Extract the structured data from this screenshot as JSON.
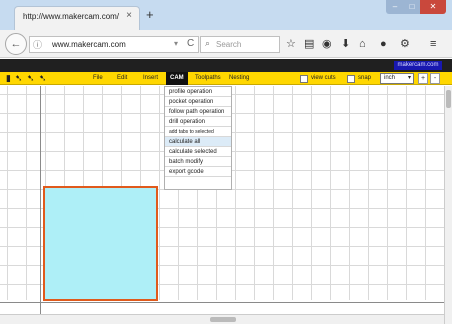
{
  "browser": {
    "tab_title": "http://www.makercam.com/",
    "close_glyph": "×",
    "new_tab_glyph": "+",
    "window_minimize": "–",
    "window_maximize": "□",
    "window_close": "✕",
    "back_glyph": "←",
    "url": "www.makercam.com",
    "url_dropdown_glyph": "▾",
    "reload_glyph": "C",
    "search_placeholder": "Search",
    "nav_icons": [
      "star-icon",
      "reading-list-icon",
      "pocket-icon",
      "download-icon",
      "home-icon",
      "chat-icon",
      "menu-icon"
    ]
  },
  "app": {
    "top_link": "makercam.com",
    "toolbar": {
      "icons": [
        "select-arrow-icon",
        "pen-tool-icon",
        "node-edit-icon",
        "node-add-icon"
      ],
      "menu": [
        "File",
        "Edit",
        "Insert",
        "CAM",
        "Toolpaths",
        "Nesting"
      ],
      "active_menu": "CAM",
      "view_cuts_label": "view cuts",
      "snap_label": "snap",
      "units_value": "inch",
      "units_arrow": "▾",
      "zoom_in": "+",
      "zoom_out": "-"
    },
    "cam_menu": {
      "items": [
        "profile operation",
        "pocket operation",
        "follow path operation",
        "drill operation",
        "add tabs to selected",
        "calculate all",
        "calculate selected",
        "batch modify",
        "export gcode"
      ],
      "highlighted": "calculate all"
    }
  },
  "colors": {
    "toolbar": "#ffd700",
    "shape_fill": "#aeeff7",
    "shape_stroke": "#e05a1c",
    "titlebar": "#c6dbf0",
    "top_link": "#1818b0"
  }
}
